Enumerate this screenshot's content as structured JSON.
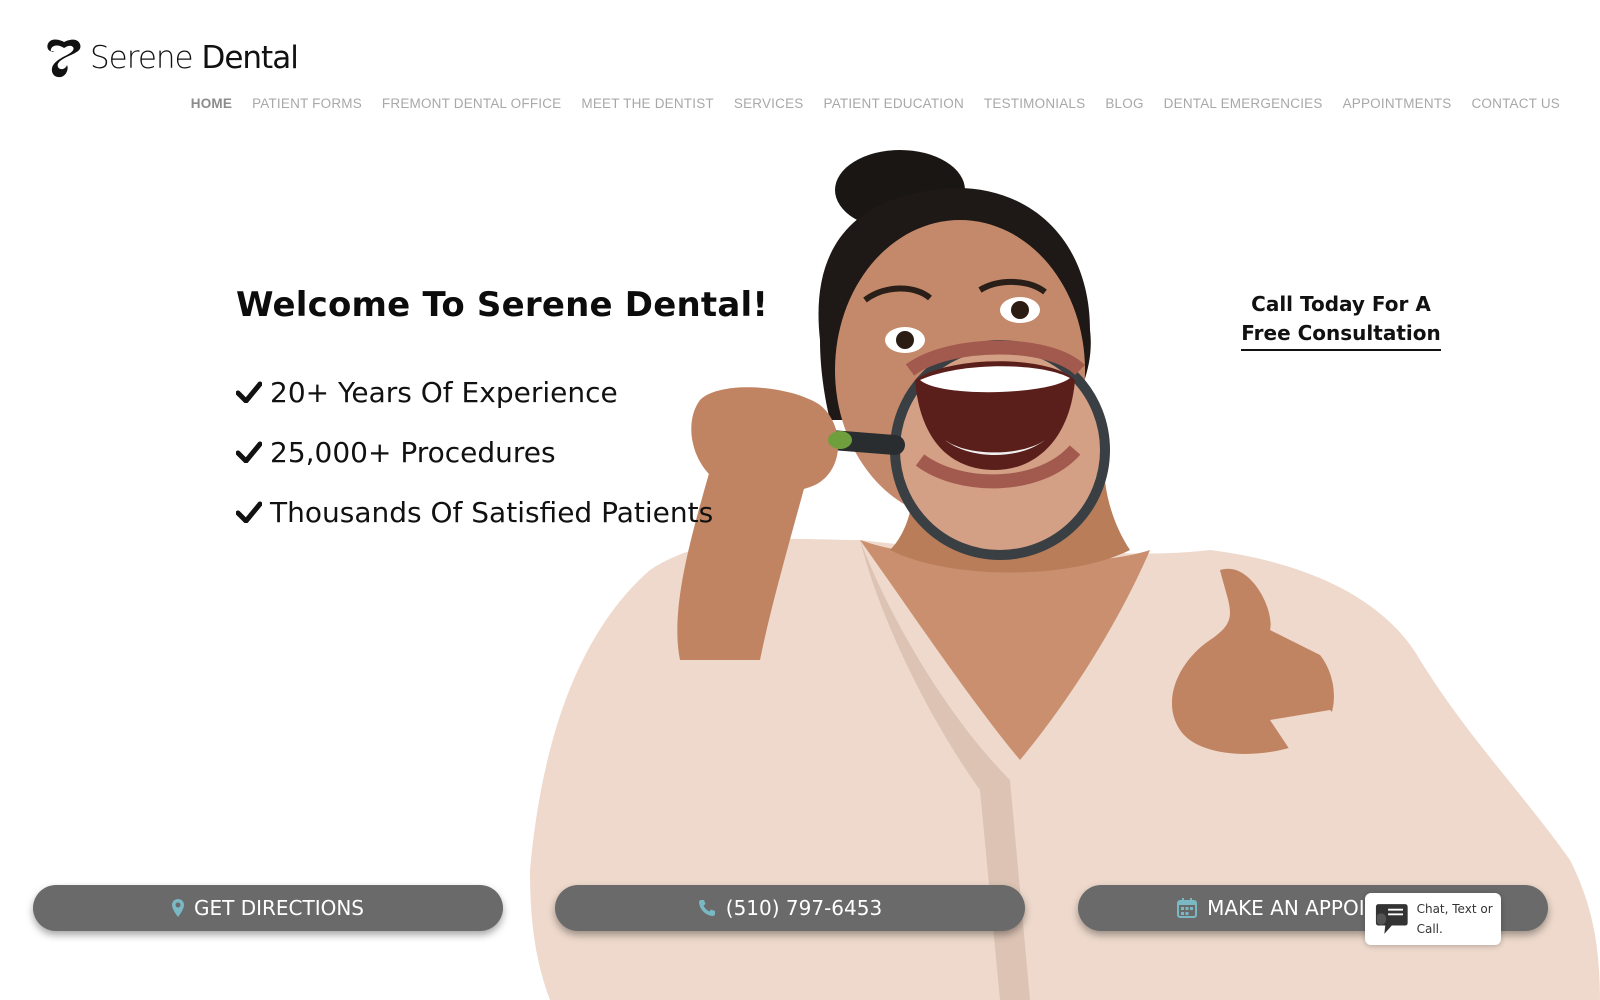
{
  "brand": {
    "name_part1": "Serene",
    "name_part2": "Dental"
  },
  "nav": {
    "items": [
      {
        "label": "HOME",
        "active": true
      },
      {
        "label": "PATIENT FORMS"
      },
      {
        "label": "FREMONT DENTAL OFFICE"
      },
      {
        "label": "MEET THE DENTIST"
      },
      {
        "label": "SERVICES"
      },
      {
        "label": "PATIENT EDUCATION"
      },
      {
        "label": "TESTIMONIALS"
      },
      {
        "label": "BLOG"
      },
      {
        "label": "DENTAL EMERGENCIES"
      },
      {
        "label": "APPOINTMENTS"
      },
      {
        "label": "CONTACT US"
      }
    ]
  },
  "hero": {
    "title": "Welcome To Serene Dental!",
    "features": [
      "20+ Years Of Experience",
      "25,000+ Procedures",
      "Thousands Of Satisfied Patients"
    ],
    "cta_line1": "Call Today For A",
    "cta_line2": "Free Consultation"
  },
  "buttons": {
    "directions": "GET DIRECTIONS",
    "phone": "(510) 797-6453",
    "appointment": "MAKE AN APPOINTMENT"
  },
  "chat": {
    "label": "Chat, Text or Call."
  },
  "icons": {
    "logo": "tooth-logo-icon",
    "check": "check-icon",
    "directions": "map-pin-icon",
    "phone": "phone-icon",
    "appointment": "calendar-icon",
    "chat": "chat-bubble-icon"
  },
  "colors": {
    "button_bg": "#6a6a6a",
    "icon_accent": "#7ab8c4",
    "nav_text": "#a8a8a8",
    "nav_active": "#8c8c8c"
  }
}
